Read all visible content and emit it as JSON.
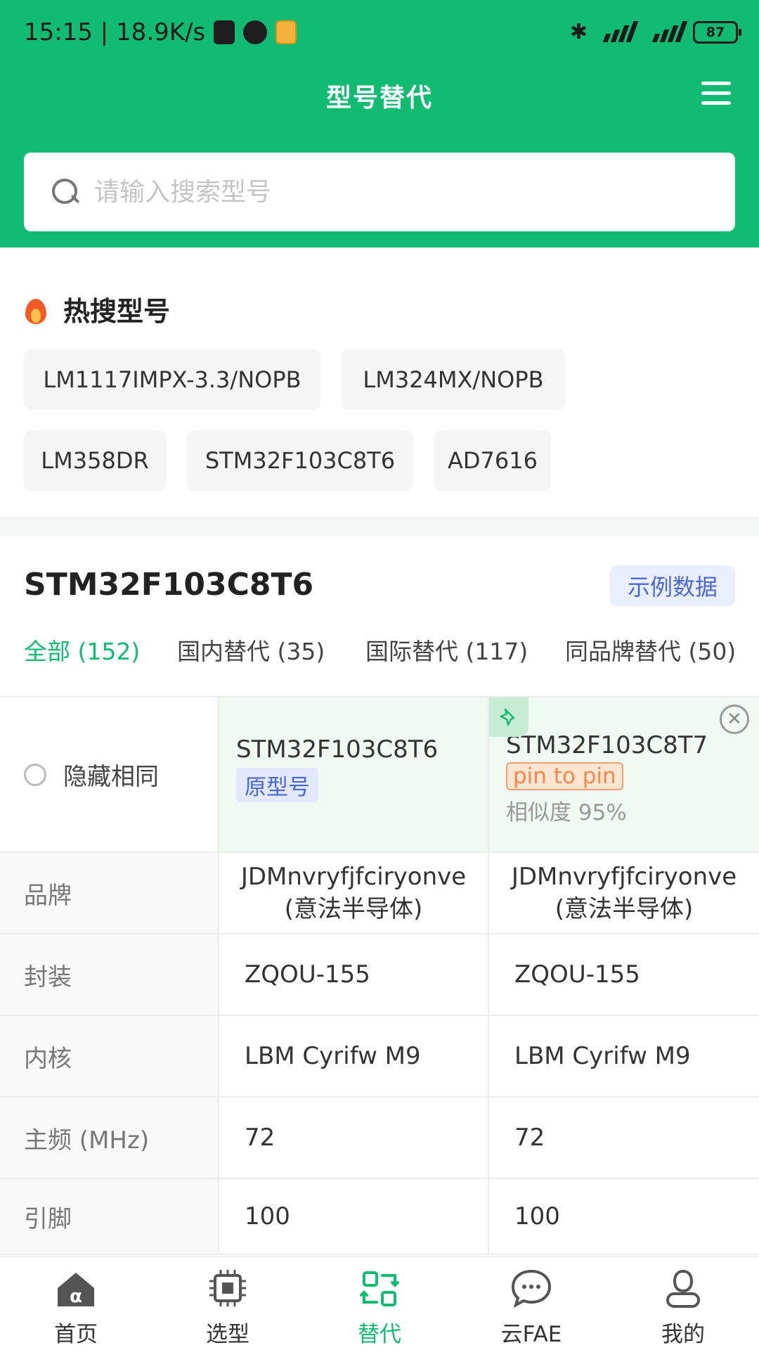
{
  "status_bar": {
    "time_speed": "15:15 | 18.9K/s",
    "battery": "87"
  },
  "header": {
    "title": "型号替代"
  },
  "search": {
    "placeholder": "请输入搜索型号"
  },
  "hot_search": {
    "title": "热搜型号",
    "chips": [
      "LM1117IMPX-3.3/NOPB",
      "LM324MX/NOPB",
      "LM358DR",
      "STM32F103C8T6",
      "AD7616"
    ]
  },
  "section": {
    "part_number": "STM32F103C8T6",
    "example_label": "示例数据",
    "tabs": [
      {
        "label": "全部 (152)"
      },
      {
        "label": "国内替代 (35)"
      },
      {
        "label": "国际替代 (117)"
      },
      {
        "label": "同品牌替代 (50)"
      }
    ]
  },
  "table": {
    "hide_same_label": "隐藏相同",
    "original": {
      "part": "STM32F103C8T6",
      "tag": "原型号"
    },
    "alternative": {
      "part": "STM32F103C8T7",
      "tag": "pin to pin",
      "similarity": "相似度 95%"
    },
    "rows": [
      {
        "label": "品牌",
        "original": "JDMnvryfjfciryonve\n(意法半导体)",
        "original_l1": "JDMnvryfjfciryonve",
        "original_l2": "(意法半导体)",
        "alt_l1": "JDMnvryfjfciryonve",
        "alt_l2": "(意法半导体)"
      },
      {
        "label": "封装",
        "original": "ZQOU-155",
        "alt": "ZQOU-155"
      },
      {
        "label": "内核",
        "original": "LBM Cyrifw M9",
        "alt": "LBM Cyrifw M9"
      },
      {
        "label": "主频 (MHz)",
        "original": "72",
        "alt": "72"
      },
      {
        "label": "引脚",
        "original": "100",
        "alt": "100"
      }
    ]
  },
  "bottom_nav": [
    {
      "label": "首页",
      "icon": "home-icon"
    },
    {
      "label": "选型",
      "icon": "chip-icon"
    },
    {
      "label": "替代",
      "icon": "swap-icon"
    },
    {
      "label": "云FAE",
      "icon": "chat-icon"
    },
    {
      "label": "我的",
      "icon": "user-icon"
    }
  ],
  "colors": {
    "brand": "#12bb72",
    "tag_blue": "#4a67d6",
    "tag_orange": "#f3884a"
  }
}
